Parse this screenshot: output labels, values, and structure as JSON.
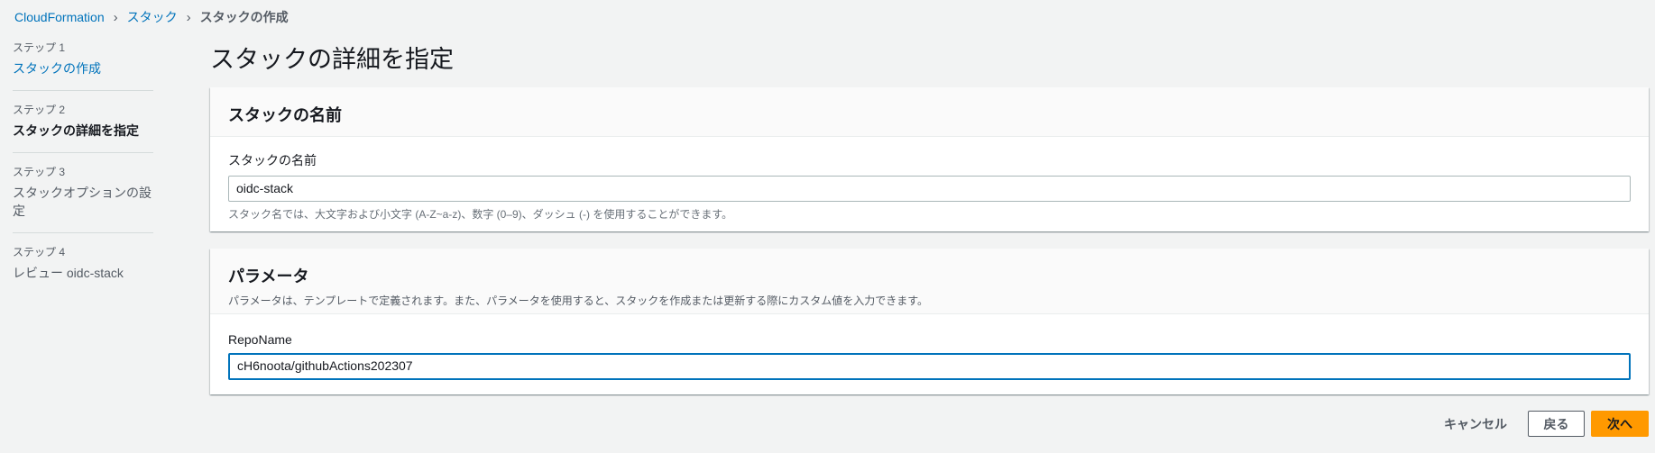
{
  "breadcrumb": [
    "CloudFormation",
    "スタック",
    "スタックの作成"
  ],
  "sidebar": {
    "steps": [
      {
        "label": "ステップ 1",
        "name": "スタックの作成"
      },
      {
        "label": "ステップ 2",
        "name": "スタックの詳細を指定"
      },
      {
        "label": "ステップ 3",
        "name": "スタックオプションの設定"
      },
      {
        "label": "ステップ 4",
        "name": "レビュー oidc-stack"
      }
    ]
  },
  "page_title": "スタックの詳細を指定",
  "stack_name_section": {
    "title": "スタックの名前",
    "field_label": "スタックの名前",
    "value": "oidc-stack",
    "help": "スタック名では、大文字および小文字 (A-Z~a-z)、数字 (0–9)、ダッシュ (-) を使用することができます。"
  },
  "parameters_section": {
    "title": "パラメータ",
    "description": "パラメータは、テンプレートで定義されます。また、パラメータを使用すると、スタックを作成または更新する際にカスタム値を入力できます。",
    "field_label": "RepoName",
    "value": "cH6noota/githubActions202307"
  },
  "actions": {
    "cancel": "キャンセル",
    "back": "戻る",
    "next": "次へ"
  },
  "colors": {
    "link": "#0073bb",
    "primary": "#ff9900"
  }
}
